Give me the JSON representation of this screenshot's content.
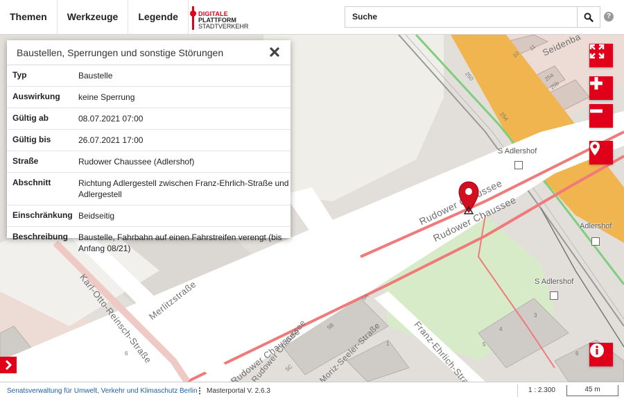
{
  "menu": {
    "items": [
      {
        "label": "Themen"
      },
      {
        "label": "Werkzeuge"
      },
      {
        "label": "Legende"
      }
    ]
  },
  "logo": {
    "line1": "DIGITALE",
    "line2": "PLATTFORM",
    "line3": "STADTVERKEHR"
  },
  "search": {
    "value": "Suche"
  },
  "popup": {
    "title": "Baustellen, Sperrungen und sonstige Störungen",
    "rows": [
      {
        "key": "Typ",
        "value": "Baustelle"
      },
      {
        "key": "Auswirkung",
        "value": "keine Sperrung"
      },
      {
        "key": "Gültig ab",
        "value": "08.07.2021 07:00"
      },
      {
        "key": "Gültig bis",
        "value": "26.07.2021 17:00"
      },
      {
        "key": "Straße",
        "value": "Rudower Chaussee (Adlershof)"
      },
      {
        "key": "Abschnitt",
        "value": "Richtung Adlergestell zwischen Franz-Ehrlich-Straße und Adlergestell"
      },
      {
        "key": "Einschränkung",
        "value": "Beidseitig"
      },
      {
        "key": "Beschreibung",
        "value": "Baustelle, Fahrbahn auf einen Fahrstreifen verengt (bis Anfang 08/21)"
      }
    ]
  },
  "map": {
    "street_labels": [
      "Seidenba",
      "Rudower Chaussee",
      "Rudower Chaussee",
      "Karl-Otto-Reinsch-Straße",
      "Merlitzstraße",
      "Rudower Chaussee",
      "Rudower Chaussee",
      "Moriz-Seeler-Straße",
      "Franz-Ehrlich-Straße"
    ],
    "stop_labels": [
      "S Adlershof",
      "Adlershof",
      "S Adlershof"
    ],
    "house_numbers": [
      "250",
      "254",
      "25a",
      "25b",
      "5A",
      "5B",
      "5C",
      "6",
      "1",
      "3",
      "4",
      "5",
      "6",
      "11",
      "10"
    ]
  },
  "controls": {
    "fullscreen_icon": "expand-icon",
    "zoom_in_icon": "plus-icon",
    "zoom_out_icon": "minus-icon",
    "locate_icon": "location-pin-icon",
    "info_icon": "info-icon"
  },
  "footer": {
    "org": "Senatsverwaltung für Umwelt, Verkehr und Klimaschutz Berlin",
    "menu_dots": "⋮",
    "version": "Masterportal V. 2.6.3",
    "scale": "1 : 2.300",
    "scalebar": "45 m"
  },
  "colors": {
    "accent": "#e10019",
    "road_highlight": "#f07a7a",
    "railway": "#f0b24a"
  }
}
